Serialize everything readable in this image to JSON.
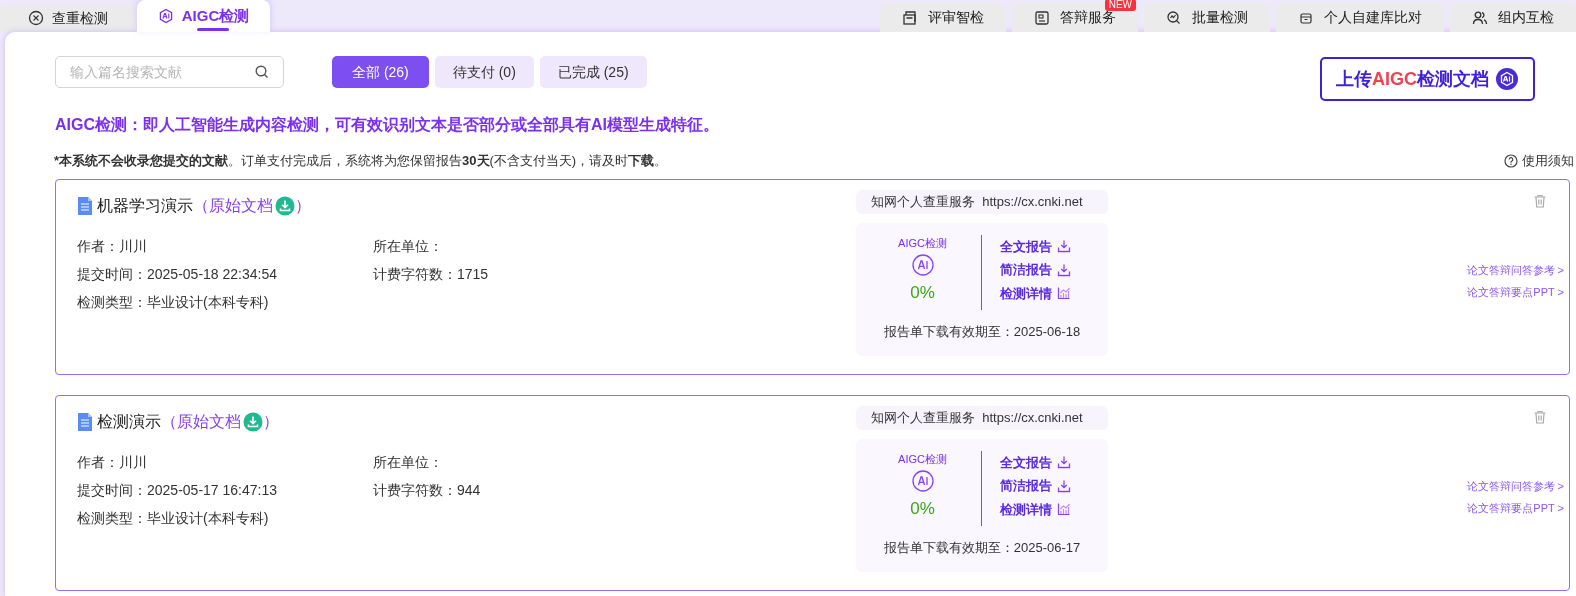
{
  "left_tabs": [
    {
      "label": "查重检测",
      "selected": false
    },
    {
      "label": "AIGC检测",
      "selected": true
    }
  ],
  "right_tabs": [
    {
      "label": "评审智检"
    },
    {
      "label": "答辩服务",
      "badge": "NEW"
    },
    {
      "label": "批量检测"
    },
    {
      "label": "个人自建库比对"
    },
    {
      "label": "组内互检"
    }
  ],
  "search": {
    "placeholder": "输入篇名搜索文献"
  },
  "filters": [
    {
      "label": "全部 (26)",
      "selected": true
    },
    {
      "label": "待支付 (0)",
      "selected": false
    },
    {
      "label": "已完成 (25)",
      "selected": false
    }
  ],
  "upload_button": {
    "parts": [
      {
        "text": "上传",
        "highlight": false
      },
      {
        "text": "AIGC",
        "highlight": true
      },
      {
        "text": "检测文档",
        "highlight": false
      }
    ]
  },
  "intro": "AIGC检测：即人工智能生成内容检测，可有效识别文本是否部分或全部具有AI模型生成特征。",
  "notice": "***本系统不会收录您提交的文献**。订单支付完成后，系统将为您保留报告**30天**(不含支付当天)，请及时**下载**。",
  "help_link": "使用须知",
  "records": [
    {
      "title": "机器学习演示",
      "source_open": "（原始文档",
      "source_close": "）",
      "meta_left": [
        "作者：川川",
        "提交时间：2025-05-18 22:34:54",
        "检测类型：毕业设计(本科专科)"
      ],
      "meta_right": [
        "所在单位：",
        "计费字符数：1715"
      ],
      "service": "知网个人查重服务  https://cx.cnki.net",
      "detect_label": "AIGC检测",
      "score": "0%",
      "actions": [
        {
          "label": "全文报告",
          "kind": "download"
        },
        {
          "label": "简洁报告",
          "kind": "download"
        },
        {
          "label": "检测详情",
          "kind": "chart"
        }
      ],
      "validity": "报告单下载有效期至：2025-06-18",
      "side_links": [
        "论文答辩问答参考 >",
        "论文答辩要点PPT >"
      ]
    },
    {
      "title": "检测演示",
      "source_open": "（原始文档",
      "source_close": "）",
      "meta_left": [
        "作者：川川",
        "提交时间：2025-05-17 16:47:13",
        "检测类型：毕业设计(本科专科)"
      ],
      "meta_right": [
        "所在单位：",
        "计费字符数：944"
      ],
      "service": "知网个人查重服务  https://cx.cnki.net",
      "detect_label": "AIGC检测",
      "score": "0%",
      "actions": [
        {
          "label": "全文报告",
          "kind": "download"
        },
        {
          "label": "简洁报告",
          "kind": "download"
        },
        {
          "label": "检测详情",
          "kind": "chart"
        }
      ],
      "validity": "报告单下载有效期至：2025-06-17",
      "side_links": [
        "论文答辩问答参考 >",
        "论文答辩要点PPT >"
      ]
    }
  ]
}
